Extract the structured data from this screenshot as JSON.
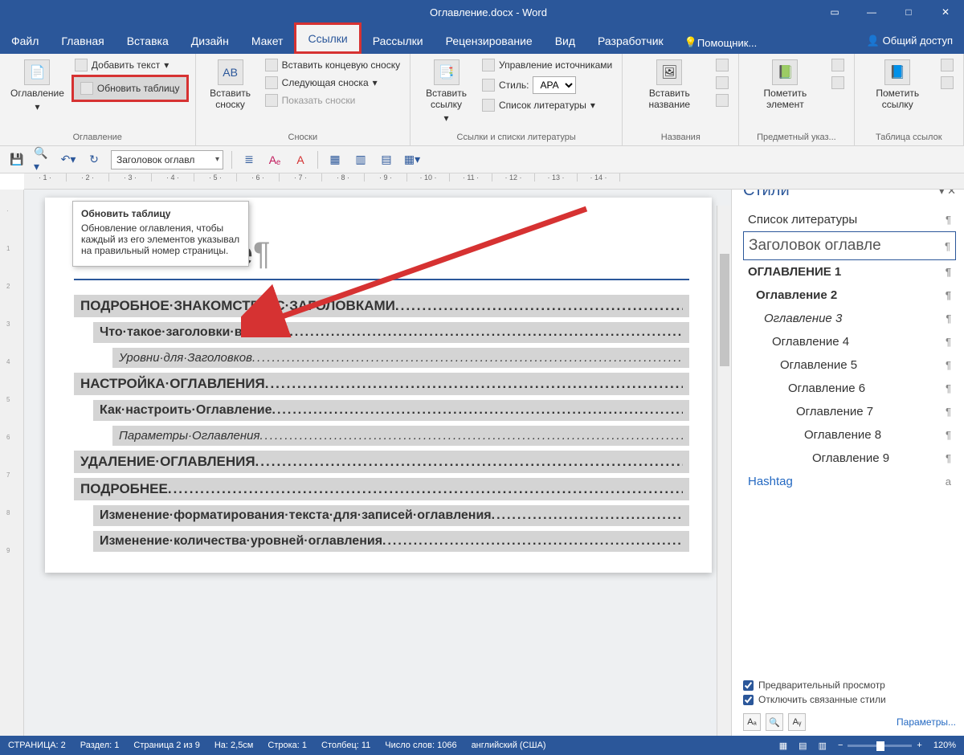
{
  "title": "Оглавление.docx - Word",
  "menubar": {
    "file": "Файл",
    "home": "Главная",
    "insert": "Вставка",
    "design": "Дизайн",
    "layout": "Макет",
    "references": "Ссылки",
    "mailings": "Рассылки",
    "review": "Рецензирование",
    "view": "Вид",
    "developer": "Разработчик",
    "help": "Помощник...",
    "share": "Общий доступ"
  },
  "ribbon": {
    "toc": {
      "btn": "Оглавление",
      "add_text": "Добавить текст",
      "update": "Обновить таблицу",
      "group": "Оглавление"
    },
    "footnotes": {
      "insert": "Вставить сноску",
      "ab": "AB",
      "end": "Вставить концевую сноску",
      "next": "Следующая сноска",
      "show": "Показать сноски",
      "group": "Сноски"
    },
    "citations": {
      "insert": "Вставить ссылку",
      "manage": "Управление источниками",
      "style_label": "Стиль:",
      "style_value": "APA",
      "biblio": "Список литературы",
      "group": "Ссылки и списки литературы"
    },
    "captions": {
      "btn": "Вставить название",
      "group": "Названия"
    },
    "index": {
      "btn": "Пометить элемент",
      "group": "Предметный указ..."
    },
    "toa": {
      "btn": "Пометить ссылку",
      "group": "Таблица ссылок"
    }
  },
  "qat": {
    "style_select": "Заголовок оглавл"
  },
  "tooltip": {
    "title": "Обновить таблицу",
    "body": "Обновление оглавления, чтобы каждый из его элементов указывал на правильный номер страницы."
  },
  "ruler_ticks": [
    "1",
    "2",
    "3",
    "4",
    "5",
    "6",
    "7",
    "8",
    "9",
    "10",
    "11",
    "12",
    "13",
    "14"
  ],
  "doc": {
    "title": "Оглавление",
    "toc": [
      {
        "lvl": 1,
        "text": "ПОДРОБНОЕ·ЗНАКОМСТВО·С·ЗАГОЛОВКАМИ"
      },
      {
        "lvl": 2,
        "text": "Что·такое·заголовки·в·Word"
      },
      {
        "lvl": 3,
        "text": "Уровни·для·Заголовков"
      },
      {
        "lvl": 1,
        "text": "НАСТРОЙКА·ОГЛАВЛЕНИЯ"
      },
      {
        "lvl": 2,
        "text": "Как·настроить·Оглавление"
      },
      {
        "lvl": 3,
        "text": "Параметры·Оглавления"
      },
      {
        "lvl": 1,
        "text": "УДАЛЕНИЕ·ОГЛАВЛЕНИЯ"
      },
      {
        "lvl": 1,
        "text": "ПОДРОБНЕЕ"
      },
      {
        "lvl": 2,
        "text": "Изменение·форматирования·текста·для·записей·оглавления"
      },
      {
        "lvl": 2,
        "text": "Изменение·количества·уровней·оглавления"
      }
    ]
  },
  "styles": {
    "title": "Стили",
    "items": [
      {
        "name": "Список литературы",
        "cls": ""
      },
      {
        "name": "Заголовок оглавле",
        "cls": "sel"
      },
      {
        "name": "ОГЛАВЛЕНИЕ 1",
        "cls": "bold"
      },
      {
        "name": "Оглавление 2",
        "cls": "bold"
      },
      {
        "name": "Оглавление 3",
        "cls": "ital"
      },
      {
        "name": "Оглавление 4",
        "cls": ""
      },
      {
        "name": "Оглавление 5",
        "cls": ""
      },
      {
        "name": "Оглавление 6",
        "cls": ""
      },
      {
        "name": "Оглавление 7",
        "cls": ""
      },
      {
        "name": "Оглавление 8",
        "cls": ""
      },
      {
        "name": "Оглавление 9",
        "cls": ""
      },
      {
        "name": "Hashtag",
        "cls": "blue",
        "mark": "a"
      }
    ],
    "chk_preview": "Предварительный просмотр",
    "chk_linked": "Отключить связанные стили",
    "params": "Параметры..."
  },
  "status": {
    "page": "СТРАНИЦА: 2",
    "section": "Раздел: 1",
    "pageof": "Страница 2 из 9",
    "at": "На: 2,5см",
    "row": "Строка: 1",
    "col": "Столбец: 11",
    "words": "Число слов: 1066",
    "lang": "английский (США)",
    "zoom": "120%"
  }
}
